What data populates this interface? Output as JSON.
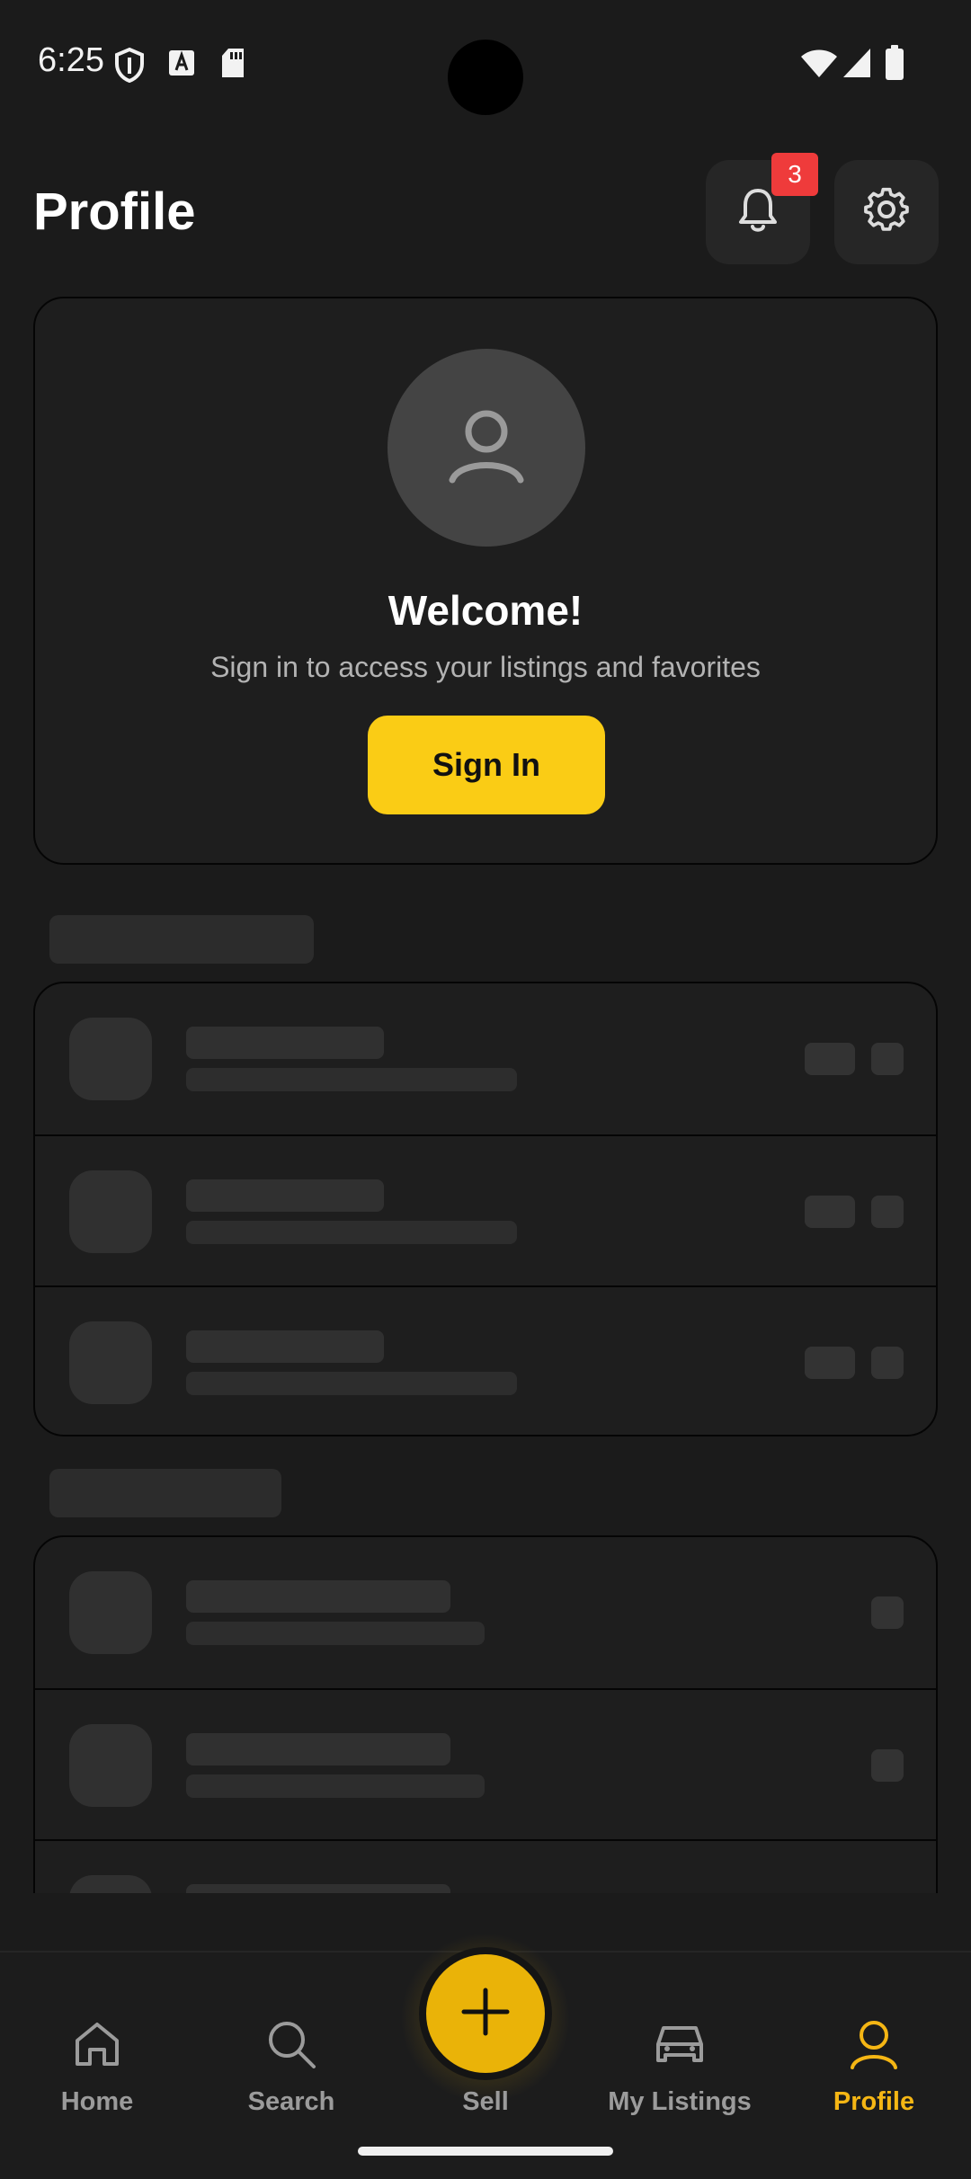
{
  "status_bar": {
    "time": "6:25",
    "icons": [
      "shield-icon",
      "font-download-icon",
      "sd-card-icon",
      "wifi-icon",
      "cell-signal-icon",
      "battery-icon"
    ]
  },
  "header": {
    "title": "Profile",
    "notification_count": "3",
    "icons": [
      "bell-icon",
      "gear-icon"
    ]
  },
  "welcome": {
    "title": "Welcome!",
    "subtitle": "Sign in to access your listings and favorites",
    "button_label": "Sign In",
    "icons": [
      "user-icon"
    ]
  },
  "bottom_nav": {
    "items": [
      {
        "label": "Home",
        "icon": "home-icon",
        "active": false
      },
      {
        "label": "Search",
        "icon": "search-icon",
        "active": false
      },
      {
        "label": "Sell",
        "icon": "plus-icon",
        "active": false
      },
      {
        "label": "My Listings",
        "icon": "car-icon",
        "active": false
      },
      {
        "label": "Profile",
        "icon": "user-icon",
        "active": true
      }
    ]
  },
  "colors": {
    "background": "#1b1b1b",
    "accent": "#facc15",
    "active_nav": "#f5b614",
    "badge": "#ef3b3b"
  }
}
